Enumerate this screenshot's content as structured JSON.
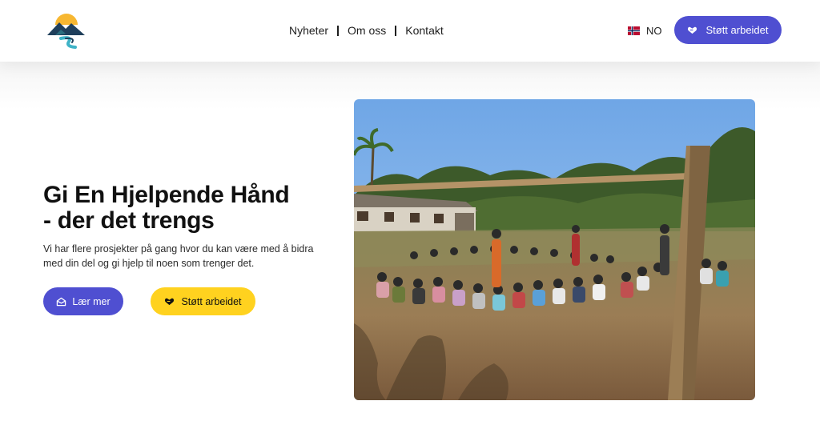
{
  "header": {
    "nav": [
      {
        "label": "Nyheter"
      },
      {
        "label": "Om oss"
      },
      {
        "label": "Kontakt"
      }
    ],
    "language": {
      "code": "NO",
      "flag_icon": "norway-flag-icon"
    },
    "support_button": {
      "label": "Støtt arbeidet",
      "icon": "heart-hand-icon"
    }
  },
  "hero": {
    "title_line1": "Gi En Hjelpende Hånd",
    "title_line2": "- der det trengs",
    "text": "Vi har flere prosjekter på gang hvor du kan være med å bidra med din del og gi hjelp til noen som trenger det.",
    "learn_button": {
      "label": "Lær mer",
      "icon": "mail-open-icon"
    },
    "support_button": {
      "label": "Støtt arbeidet",
      "icon": "heart-hand-icon"
    }
  },
  "colors": {
    "primary": "#4f4fd1",
    "accent_yellow": "#ffd21f"
  }
}
